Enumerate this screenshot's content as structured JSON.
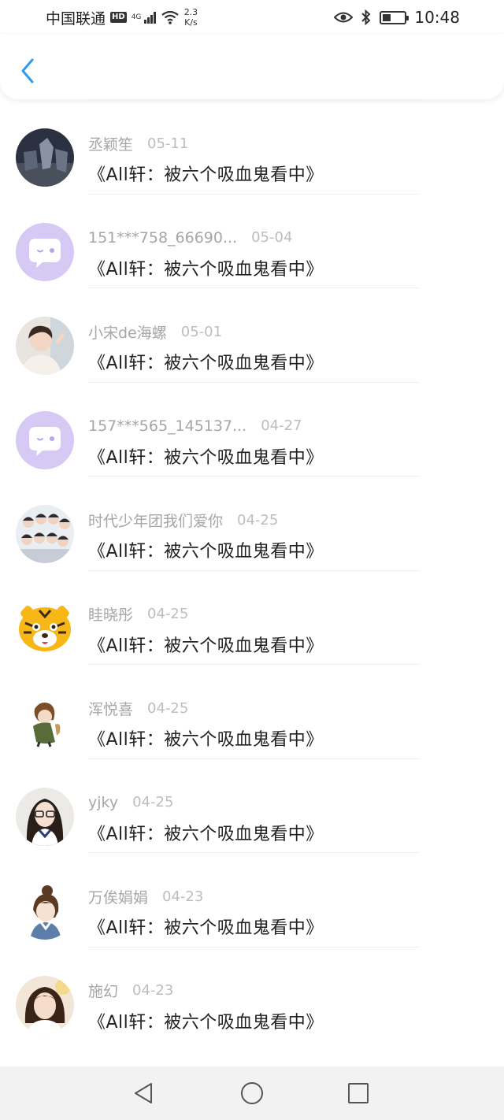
{
  "status_bar": {
    "carrier": "中国联通",
    "hd": "HD",
    "network": "4G",
    "speed_value": "2.3",
    "speed_unit": "K/s",
    "time": "10:48",
    "battery_level": 0.4
  },
  "header": {
    "back_icon": "chevron-left-icon",
    "accent_color": "#2f9bf0"
  },
  "comments": [
    {
      "username": "丞颖笙",
      "date": "05-11",
      "content": "《All轩：被六个吸血鬼看中》",
      "avatar": "photo-dark"
    },
    {
      "username": "151***758_66690...",
      "date": "05-04",
      "content": "《All轩：被六个吸血鬼看中》",
      "avatar": "default-chat-bubble"
    },
    {
      "username": "小宋de海螺",
      "date": "05-01",
      "content": "《All轩：被六个吸血鬼看中》",
      "avatar": "photo-person"
    },
    {
      "username": "157***565_145137...",
      "date": "04-27",
      "content": "《All轩：被六个吸血鬼看中》",
      "avatar": "default-chat-bubble"
    },
    {
      "username": "时代少年团我们爱你",
      "date": "04-25",
      "content": "《All轩：被六个吸血鬼看中》",
      "avatar": "photo-group"
    },
    {
      "username": "眭晓彤",
      "date": "04-25",
      "content": "《All轩：被六个吸血鬼看中》",
      "avatar": "tiger-cartoon"
    },
    {
      "username": "浑悦喜",
      "date": "04-25",
      "content": "《All轩：被六个吸血鬼看中》",
      "avatar": "anime-figure"
    },
    {
      "username": "yjky",
      "date": "04-25",
      "content": "《All轩：被六个吸血鬼看中》",
      "avatar": "photo-girl-glasses"
    },
    {
      "username": "万俟娟娟",
      "date": "04-23",
      "content": "《All轩：被六个吸血鬼看中》",
      "avatar": "anime-character"
    },
    {
      "username": "施幻",
      "date": "04-23",
      "content": "《All轩：被六个吸血鬼看中》",
      "avatar": "photo-girl"
    }
  ],
  "bottom_nav": {
    "back": "triangle-back-icon",
    "home": "circle-home-icon",
    "recents": "square-recents-icon"
  }
}
